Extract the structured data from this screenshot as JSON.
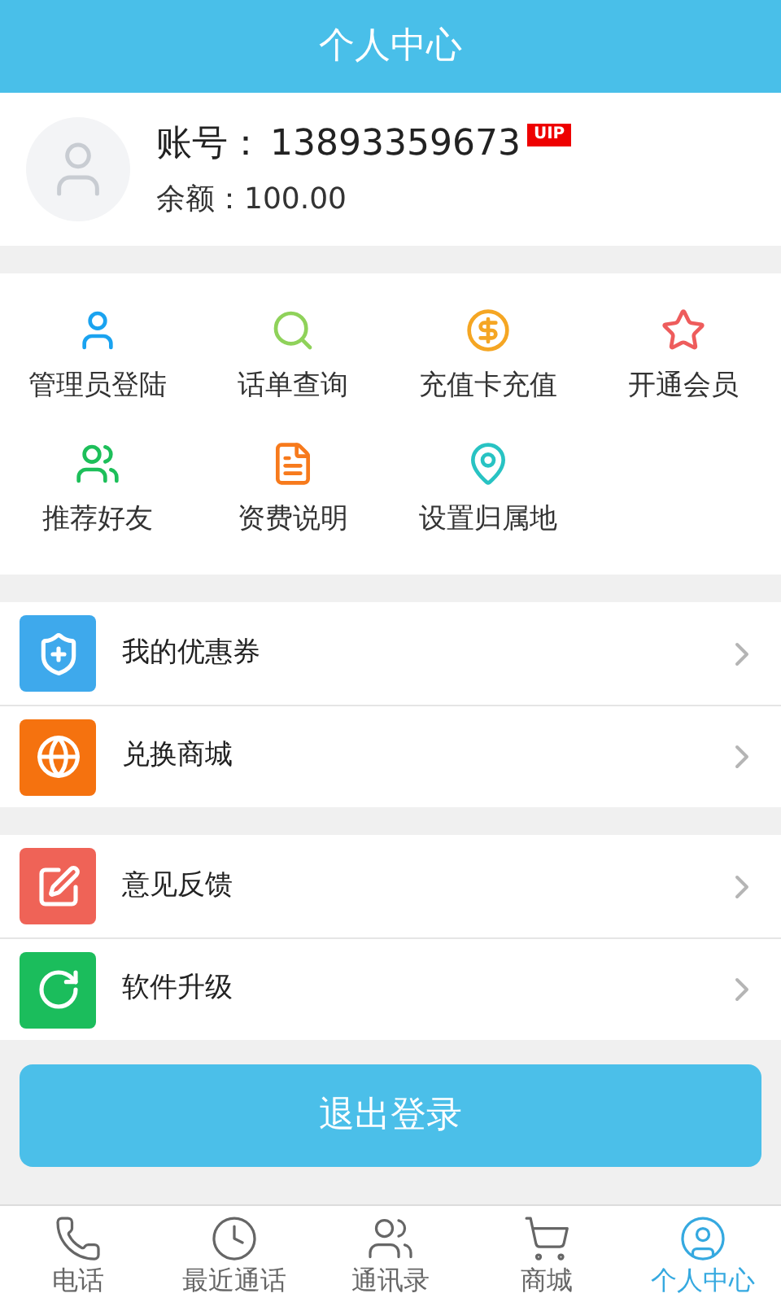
{
  "header": {
    "title": "个人中心"
  },
  "profile": {
    "account_label": "账号：",
    "account": "13893359673",
    "badge": "UIP",
    "balance_label": "余额：",
    "balance": "100.00"
  },
  "grid": [
    {
      "label": "管理员登陆",
      "color": "#1aa3f0"
    },
    {
      "label": "话单查询",
      "color": "#8fd25a"
    },
    {
      "label": "充值卡充值",
      "color": "#f5a623"
    },
    {
      "label": "开通会员",
      "color": "#ee5c5c"
    },
    {
      "label": "推荐好友",
      "color": "#1dbf5a"
    },
    {
      "label": "资费说明",
      "color": "#f77a1c"
    },
    {
      "label": "设置归属地",
      "color": "#28c3c3"
    }
  ],
  "groups": [
    [
      {
        "label": "我的优惠券",
        "color": "#3ea9ec"
      },
      {
        "label": "兑换商城",
        "color": "#f5720f"
      }
    ],
    [
      {
        "label": "意见反馈",
        "color": "#ef6357"
      },
      {
        "label": "软件升级",
        "color": "#1bbd5c"
      }
    ]
  ],
  "logout_button": "退出登录",
  "tabs": [
    {
      "label": "电话",
      "selected": false
    },
    {
      "label": "最近通话",
      "selected": false
    },
    {
      "label": "通讯录",
      "selected": false
    },
    {
      "label": "商城",
      "selected": false
    },
    {
      "label": "个人中心",
      "selected": true
    }
  ]
}
